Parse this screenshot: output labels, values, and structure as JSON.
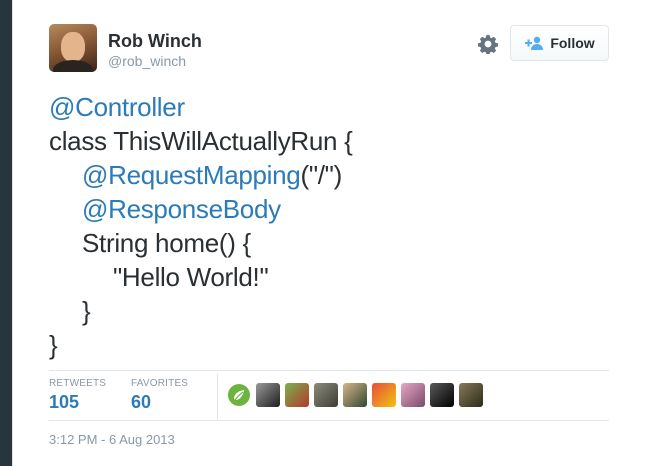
{
  "user": {
    "name": "Rob Winch",
    "handle": "@rob_winch"
  },
  "actions": {
    "follow_label": "Follow",
    "settings_icon": "gear-icon",
    "follow_icon": "person-plus-icon"
  },
  "tweet": {
    "code_lines": [
      {
        "annotation": "@Controller",
        "text": ""
      },
      {
        "annotation": "",
        "text": "class ThisWillActuallyRun {"
      },
      {
        "annotation": "@RequestMapping",
        "text": "(\"/\")"
      },
      {
        "annotation": "@ResponseBody",
        "text": ""
      },
      {
        "annotation": "",
        "text": "String home() {"
      },
      {
        "annotation": "",
        "text": "\"Hello World!\""
      },
      {
        "annotation": "",
        "text": "}"
      },
      {
        "annotation": "",
        "text": "}"
      }
    ]
  },
  "stats": {
    "retweets_label": "RETWEETS",
    "retweets_count": "105",
    "favorites_label": "FAVORITES",
    "favorites_count": "60"
  },
  "favoriters": [
    {
      "icon": "spring-leaf-icon",
      "color": "#6db33f"
    },
    {
      "icon": "avatar",
      "color": "#3a3a3a"
    },
    {
      "icon": "avatar",
      "color": "#4f8a3c"
    },
    {
      "icon": "avatar",
      "color": "#6a6a5a"
    },
    {
      "icon": "avatar",
      "color": "#3b5c3a"
    },
    {
      "icon": "avatar",
      "color": "#c0392b"
    },
    {
      "icon": "avatar",
      "color": "#b57a9a"
    },
    {
      "icon": "avatar",
      "color": "#222222"
    },
    {
      "icon": "avatar",
      "color": "#4a4a3a"
    }
  ],
  "timestamp": "3:12 PM - 6 Aug 2013",
  "colors": {
    "background": "#27353f",
    "link": "#2b7bb9",
    "text": "#292f33",
    "muted": "#8899a6"
  }
}
